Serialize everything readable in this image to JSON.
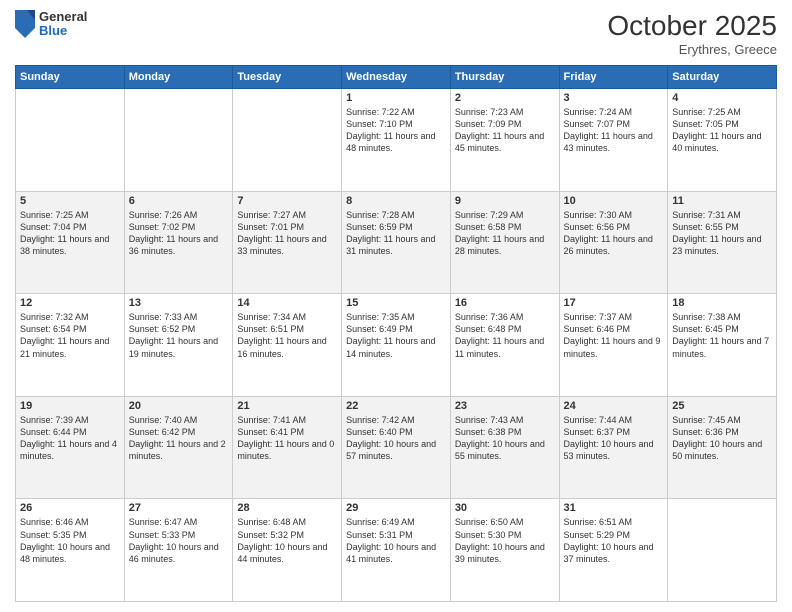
{
  "header": {
    "logo": {
      "general": "General",
      "blue": "Blue"
    },
    "title": "October 2025",
    "location": "Erythres, Greece"
  },
  "days_of_week": [
    "Sunday",
    "Monday",
    "Tuesday",
    "Wednesday",
    "Thursday",
    "Friday",
    "Saturday"
  ],
  "weeks": [
    [
      {
        "day": "",
        "info": ""
      },
      {
        "day": "",
        "info": ""
      },
      {
        "day": "",
        "info": ""
      },
      {
        "day": "1",
        "info": "Sunrise: 7:22 AM\nSunset: 7:10 PM\nDaylight: 11 hours and 48 minutes."
      },
      {
        "day": "2",
        "info": "Sunrise: 7:23 AM\nSunset: 7:09 PM\nDaylight: 11 hours and 45 minutes."
      },
      {
        "day": "3",
        "info": "Sunrise: 7:24 AM\nSunset: 7:07 PM\nDaylight: 11 hours and 43 minutes."
      },
      {
        "day": "4",
        "info": "Sunrise: 7:25 AM\nSunset: 7:05 PM\nDaylight: 11 hours and 40 minutes."
      }
    ],
    [
      {
        "day": "5",
        "info": "Sunrise: 7:25 AM\nSunset: 7:04 PM\nDaylight: 11 hours and 38 minutes."
      },
      {
        "day": "6",
        "info": "Sunrise: 7:26 AM\nSunset: 7:02 PM\nDaylight: 11 hours and 36 minutes."
      },
      {
        "day": "7",
        "info": "Sunrise: 7:27 AM\nSunset: 7:01 PM\nDaylight: 11 hours and 33 minutes."
      },
      {
        "day": "8",
        "info": "Sunrise: 7:28 AM\nSunset: 6:59 PM\nDaylight: 11 hours and 31 minutes."
      },
      {
        "day": "9",
        "info": "Sunrise: 7:29 AM\nSunset: 6:58 PM\nDaylight: 11 hours and 28 minutes."
      },
      {
        "day": "10",
        "info": "Sunrise: 7:30 AM\nSunset: 6:56 PM\nDaylight: 11 hours and 26 minutes."
      },
      {
        "day": "11",
        "info": "Sunrise: 7:31 AM\nSunset: 6:55 PM\nDaylight: 11 hours and 23 minutes."
      }
    ],
    [
      {
        "day": "12",
        "info": "Sunrise: 7:32 AM\nSunset: 6:54 PM\nDaylight: 11 hours and 21 minutes."
      },
      {
        "day": "13",
        "info": "Sunrise: 7:33 AM\nSunset: 6:52 PM\nDaylight: 11 hours and 19 minutes."
      },
      {
        "day": "14",
        "info": "Sunrise: 7:34 AM\nSunset: 6:51 PM\nDaylight: 11 hours and 16 minutes."
      },
      {
        "day": "15",
        "info": "Sunrise: 7:35 AM\nSunset: 6:49 PM\nDaylight: 11 hours and 14 minutes."
      },
      {
        "day": "16",
        "info": "Sunrise: 7:36 AM\nSunset: 6:48 PM\nDaylight: 11 hours and 11 minutes."
      },
      {
        "day": "17",
        "info": "Sunrise: 7:37 AM\nSunset: 6:46 PM\nDaylight: 11 hours and 9 minutes."
      },
      {
        "day": "18",
        "info": "Sunrise: 7:38 AM\nSunset: 6:45 PM\nDaylight: 11 hours and 7 minutes."
      }
    ],
    [
      {
        "day": "19",
        "info": "Sunrise: 7:39 AM\nSunset: 6:44 PM\nDaylight: 11 hours and 4 minutes."
      },
      {
        "day": "20",
        "info": "Sunrise: 7:40 AM\nSunset: 6:42 PM\nDaylight: 11 hours and 2 minutes."
      },
      {
        "day": "21",
        "info": "Sunrise: 7:41 AM\nSunset: 6:41 PM\nDaylight: 11 hours and 0 minutes."
      },
      {
        "day": "22",
        "info": "Sunrise: 7:42 AM\nSunset: 6:40 PM\nDaylight: 10 hours and 57 minutes."
      },
      {
        "day": "23",
        "info": "Sunrise: 7:43 AM\nSunset: 6:38 PM\nDaylight: 10 hours and 55 minutes."
      },
      {
        "day": "24",
        "info": "Sunrise: 7:44 AM\nSunset: 6:37 PM\nDaylight: 10 hours and 53 minutes."
      },
      {
        "day": "25",
        "info": "Sunrise: 7:45 AM\nSunset: 6:36 PM\nDaylight: 10 hours and 50 minutes."
      }
    ],
    [
      {
        "day": "26",
        "info": "Sunrise: 6:46 AM\nSunset: 5:35 PM\nDaylight: 10 hours and 48 minutes."
      },
      {
        "day": "27",
        "info": "Sunrise: 6:47 AM\nSunset: 5:33 PM\nDaylight: 10 hours and 46 minutes."
      },
      {
        "day": "28",
        "info": "Sunrise: 6:48 AM\nSunset: 5:32 PM\nDaylight: 10 hours and 44 minutes."
      },
      {
        "day": "29",
        "info": "Sunrise: 6:49 AM\nSunset: 5:31 PM\nDaylight: 10 hours and 41 minutes."
      },
      {
        "day": "30",
        "info": "Sunrise: 6:50 AM\nSunset: 5:30 PM\nDaylight: 10 hours and 39 minutes."
      },
      {
        "day": "31",
        "info": "Sunrise: 6:51 AM\nSunset: 5:29 PM\nDaylight: 10 hours and 37 minutes."
      },
      {
        "day": "",
        "info": ""
      }
    ]
  ]
}
